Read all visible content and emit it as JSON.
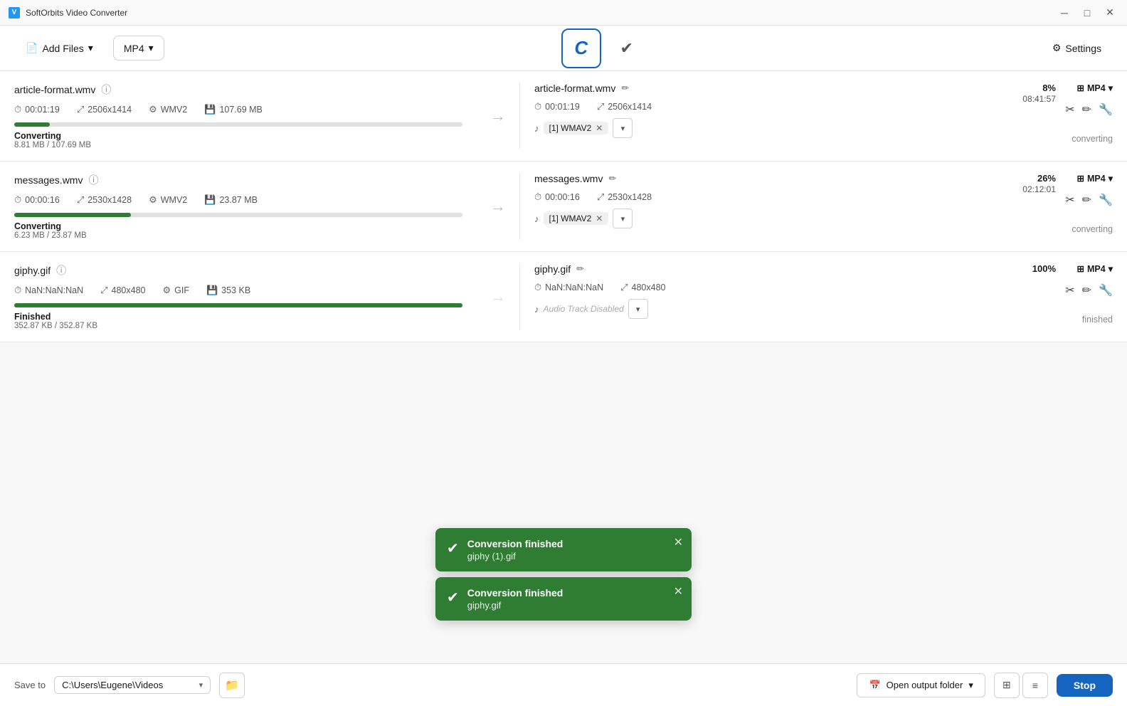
{
  "app": {
    "title": "SoftOrbits Video Converter",
    "icon": "V"
  },
  "title_bar": {
    "minimize_label": "─",
    "maximize_label": "□",
    "close_label": "✕"
  },
  "toolbar": {
    "add_files_label": "Add Files",
    "format_label": "MP4",
    "convert_label": "C",
    "check_label": "✔",
    "settings_label": "Settings",
    "settings_icon": "⚙"
  },
  "files": [
    {
      "id": "file-1",
      "name": "article-format.wmv",
      "duration": "00:01:19",
      "resolution": "2506x1414",
      "codec": "WMV2",
      "size": "107.69 MB",
      "progress_pct": 8,
      "progress_width": "8%",
      "status_label": "Converting",
      "progress_detail": "8.81 MB / 107.69 MB",
      "out_name": "article-format.wmv",
      "out_duration": "00:01:19",
      "out_resolution": "2506x1414",
      "out_format": "MP4",
      "audio_track": "[1] WMAV2",
      "converting_label": "converting",
      "percent": "8%",
      "time_remaining": "08:41:57"
    },
    {
      "id": "file-2",
      "name": "messages.wmv",
      "duration": "00:00:16",
      "resolution": "2530x1428",
      "codec": "WMV2",
      "size": "23.87 MB",
      "progress_pct": 26,
      "progress_width": "26%",
      "status_label": "Converting",
      "progress_detail": "6.23 MB / 23.87 MB",
      "out_name": "messages.wmv",
      "out_duration": "00:00:16",
      "out_resolution": "2530x1428",
      "out_format": "MP4",
      "audio_track": "[1] WMAV2",
      "converting_label": "converting",
      "percent": "26%",
      "time_remaining": "02:12:01"
    },
    {
      "id": "file-3",
      "name": "giphy.gif",
      "duration": "NaN:NaN:NaN",
      "resolution": "480x480",
      "codec": "GIF",
      "size": "353 KB",
      "progress_pct": 100,
      "progress_width": "100%",
      "status_label": "Finished",
      "progress_detail": "352.87 KB / 352.87 KB",
      "out_name": "giphy.gif",
      "out_duration": "NaN:NaN:NaN",
      "out_resolution": "480x480",
      "out_format": "MP4",
      "audio_track": "Audio Track Disabled",
      "audio_disabled": true,
      "converting_label": "finished",
      "percent": "100%",
      "time_remaining": ""
    }
  ],
  "toasts": [
    {
      "id": "toast-1",
      "title": "Conversion finished",
      "subtitle": "giphy (1).gif",
      "check": "✔"
    },
    {
      "id": "toast-2",
      "title": "Conversion finished",
      "subtitle": "giphy.gif",
      "check": "✔"
    }
  ],
  "bottom_bar": {
    "save_to_label": "Save to",
    "path": "C:\\Users\\Eugene\\Videos",
    "open_folder_label": "Open output folder",
    "stop_label": "Stop"
  }
}
